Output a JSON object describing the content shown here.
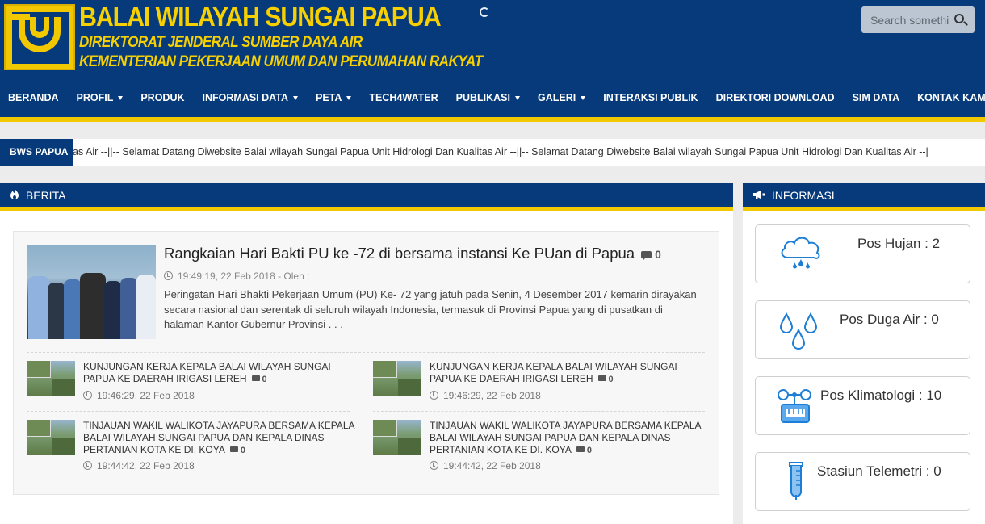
{
  "header": {
    "title": "BALAI WILAYAH SUNGAI PAPUA",
    "subtitle1": "DIREKTORAT JENDERAL SUMBER DAYA AIR",
    "subtitle2": "KEMENTERIAN PEKERJAAN UMUM DAN PERUMAHAN RAKYAT",
    "search_placeholder": "Search something..."
  },
  "nav": {
    "items": [
      {
        "label": "BERANDA",
        "dropdown": false
      },
      {
        "label": "PROFIL",
        "dropdown": true
      },
      {
        "label": "PRODUK",
        "dropdown": false
      },
      {
        "label": "INFORMASI DATA",
        "dropdown": true
      },
      {
        "label": "PETA",
        "dropdown": true
      },
      {
        "label": "TECH4WATER",
        "dropdown": false
      },
      {
        "label": "PUBLIKASI",
        "dropdown": true
      },
      {
        "label": "GALERI",
        "dropdown": true
      },
      {
        "label": "INTERAKSI PUBLIK",
        "dropdown": false
      },
      {
        "label": "DIREKTORI DOWNLOAD",
        "dropdown": false
      },
      {
        "label": "SIM DATA",
        "dropdown": false
      },
      {
        "label": "KONTAK KAMI",
        "dropdown": false
      }
    ]
  },
  "ticker": {
    "label": "BWS PAPUA",
    "message": "as Air --||-- Selamat Datang Diwebsite Balai wilayah Sungai Papua Unit Hidrologi Dan Kualitas Air --||-- Selamat Datang Diwebsite Balai wilayah Sungai Papua Unit Hidrologi Dan Kualitas Air --|"
  },
  "berita": {
    "heading": "BERITA",
    "featured": {
      "title": "Rangkaian Hari Bakti PU ke -72 di bersama instansi Ke PUan di Papua",
      "comments": "0",
      "meta": "19:49:19, 22 Feb 2018 - Oleh :",
      "description": "Peringatan Hari Bhakti Pekerjaan Umum (PU) Ke- 72 yang jatuh pada Senin, 4 Desember 2017 kemarin dirayakan secara nasional dan serentak di seluruh wilayah Indonesia, termasuk di Provinsi Papua yang di pusatkan di halaman Kantor Gubernur Provinsi . . ."
    },
    "items": [
      {
        "title": "KUNJUNGAN KERJA KEPALA BALAI WILAYAH SUNGAI PAPUA KE DAERAH IRIGASI LEREH",
        "comments": "0",
        "time": "19:46:29, 22 Feb 2018"
      },
      {
        "title": "KUNJUNGAN KERJA KEPALA BALAI WILAYAH SUNGAI PAPUA KE DAERAH IRIGASI LEREH",
        "comments": "0",
        "time": "19:46:29, 22 Feb 2018"
      },
      {
        "title": "TINJAUAN WAKIL WALIKOTA JAYAPURA BERSAMA KEPALA BALAI WILAYAH SUNGAI PAPUA DAN KEPALA DINAS PERTANIAN KOTA KE DI. KOYA",
        "comments": "0",
        "time": "19:44:42, 22 Feb 2018"
      },
      {
        "title": "TINJAUAN WAKIL WALIKOTA JAYAPURA BERSAMA KEPALA BALAI WILAYAH SUNGAI PAPUA DAN KEPALA DINAS PERTANIAN KOTA KE DI. KOYA",
        "comments": "0",
        "time": "19:44:42, 22 Feb 2018"
      }
    ]
  },
  "informasi": {
    "heading": "INFORMASI",
    "cards": [
      {
        "label": "Pos Hujan : 2",
        "icon": "rain-cloud-icon"
      },
      {
        "label": "Pos Duga Air : 0",
        "icon": "water-drops-icon"
      },
      {
        "label": "Pos Klimatologi : 10",
        "icon": "climatology-icon"
      },
      {
        "label": "Stasiun Telemetri : 0",
        "icon": "thermometer-icon"
      }
    ]
  },
  "colors": {
    "primary": "#063a7a",
    "accent": "#f2c900",
    "icon_blue": "#1d7ed6"
  }
}
